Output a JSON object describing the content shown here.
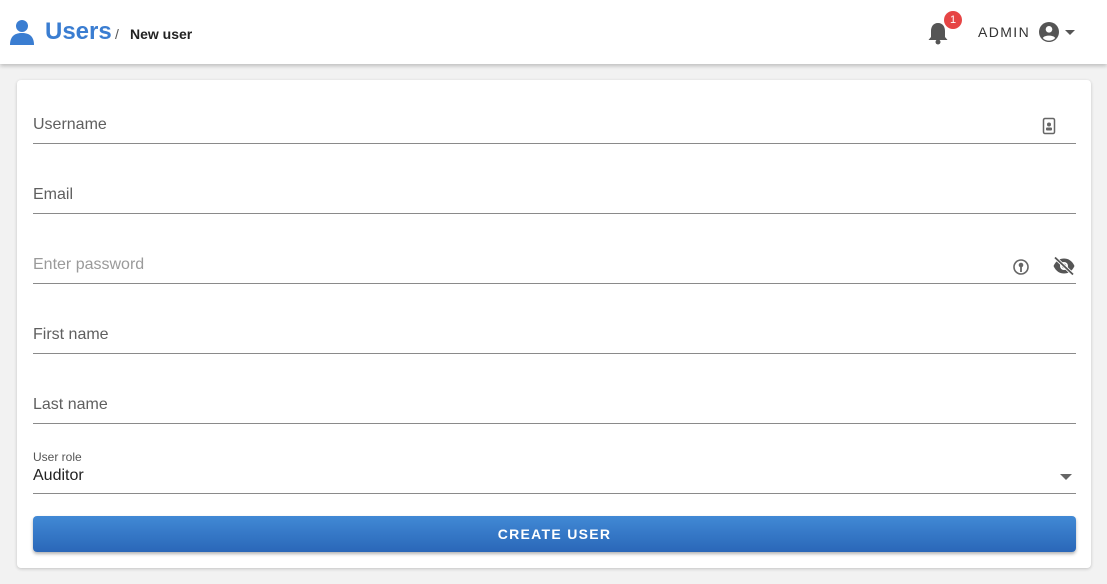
{
  "header": {
    "title": "Users",
    "separator": "/",
    "breadcrumb": "New user",
    "notifications_count": "1",
    "account_label": "ADMIN",
    "icons": {
      "title": "person-icon",
      "notifications": "bell-icon",
      "account": "account-circle-icon",
      "menu": "caret-down-icon"
    },
    "accent_color": "#3a7dd1",
    "badge_color": "#e64545"
  },
  "form": {
    "username": {
      "placeholder": "Username",
      "value": "",
      "icon": "contact-card-icon"
    },
    "email": {
      "placeholder": "Email",
      "value": ""
    },
    "password": {
      "placeholder": "Enter password",
      "value": "",
      "icons": [
        "key-icon",
        "eye-off-icon"
      ]
    },
    "first_name": {
      "placeholder": "First name",
      "value": ""
    },
    "last_name": {
      "placeholder": "Last name",
      "value": ""
    },
    "user_role": {
      "label": "User role",
      "selected": "Auditor"
    },
    "submit_label": "CREATE USER",
    "button_color": "#3479c8"
  }
}
